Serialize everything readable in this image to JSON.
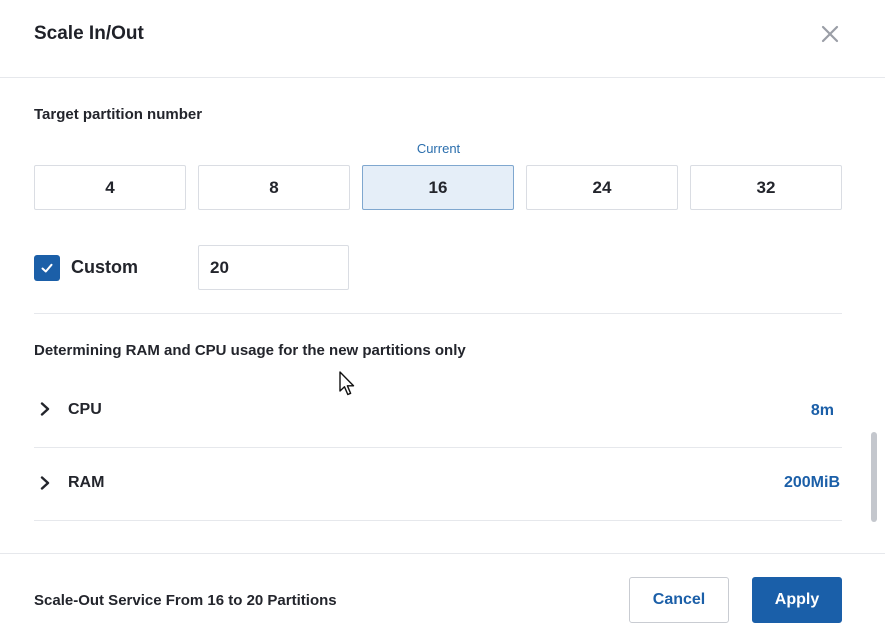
{
  "dialog": {
    "title": "Scale In/Out",
    "close_icon": "close-icon"
  },
  "partition": {
    "label": "Target partition number",
    "current_label": "Current",
    "options": [
      "4",
      "8",
      "16",
      "24",
      "32"
    ],
    "current_value": "16"
  },
  "custom": {
    "checked": true,
    "label": "Custom",
    "value": "20"
  },
  "resources": {
    "heading": "Determining RAM and CPU usage for the new partitions only",
    "items": [
      {
        "name": "CPU",
        "value": "8m",
        "icon": "chevron-right-icon"
      },
      {
        "name": "RAM",
        "value": "200MiB",
        "icon": "chevron-right-icon"
      }
    ]
  },
  "footer": {
    "summary": "Scale-Out Service From 16 to 20 Partitions",
    "cancel_label": "Cancel",
    "apply_label": "Apply"
  },
  "colors": {
    "accent": "#1b5fa8",
    "selected_bg": "#e5eef8",
    "border": "#dadde3"
  }
}
